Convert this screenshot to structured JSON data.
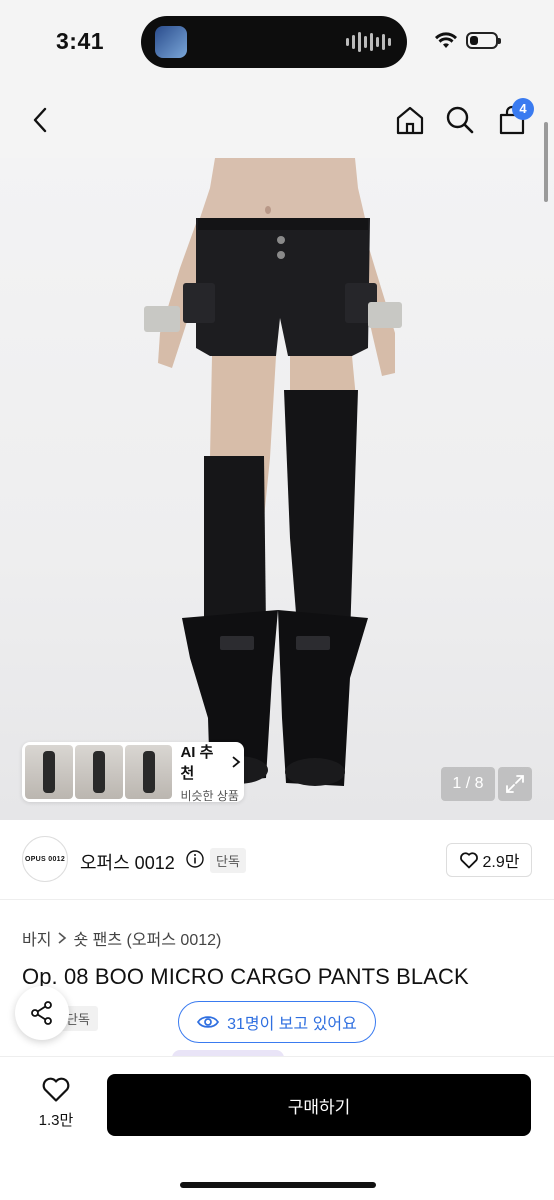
{
  "status_bar": {
    "time": "3:41",
    "battery_level": 0.35
  },
  "nav": {
    "cart_count": "4"
  },
  "gallery": {
    "ai_title": "AI 추천",
    "ai_subtitle": "비슷한 상품",
    "page_counter": "1 / 8"
  },
  "brand": {
    "logo_text": "OPUS 0012",
    "name": "오퍼스 0012",
    "tag": "단독",
    "likes": "2.9만"
  },
  "product": {
    "breadcrumb": [
      "바지",
      "숏 팬츠 (오퍼스 0012)"
    ],
    "title": "Op. 08 BOO MICRO CARGO PANTS BLACK",
    "exclusive_tag": "단독",
    "viewers": "31명이 보고 있어요"
  },
  "bottom_bar": {
    "wish_count": "1.3만",
    "buy_label": "구매하기"
  },
  "colors": {
    "accent": "#3a7bf0",
    "buy_button": "#000000"
  }
}
